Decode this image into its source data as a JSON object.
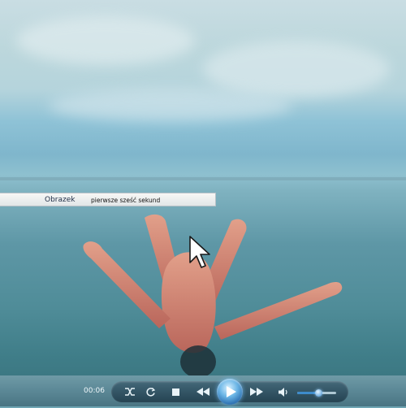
{
  "player": {
    "info": {
      "label": "Obrazek",
      "value": "pierwsze sześć sekund"
    },
    "time": "00:06",
    "volume_level": 0.55,
    "controls": {
      "shuffle": "shuffle-icon",
      "repeat": "repeat-icon",
      "stop": "stop-icon",
      "previous": "previous-icon",
      "play": "play-icon",
      "next": "next-icon",
      "mute": "volume-icon"
    },
    "accent_color": "#3e8ccb"
  }
}
